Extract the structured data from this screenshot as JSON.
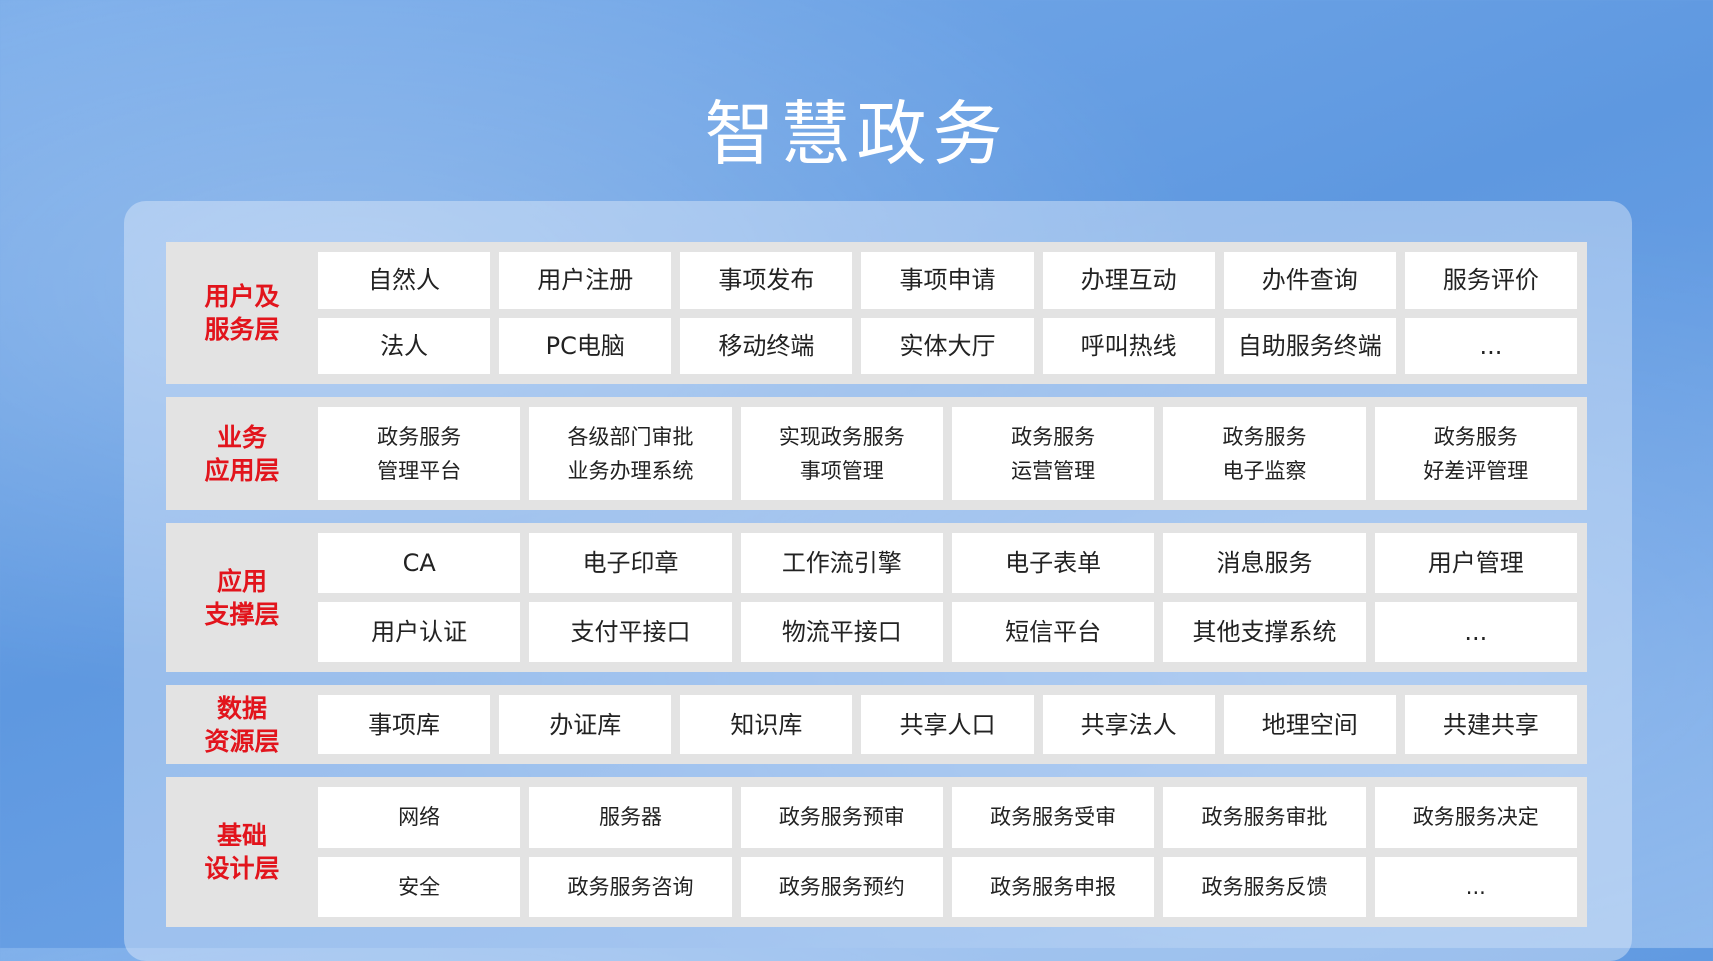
{
  "title": "智慧政务",
  "layers": [
    {
      "label": [
        "用户及",
        "服务层"
      ],
      "cells": [
        [
          "自然人"
        ],
        [
          "用户注册"
        ],
        [
          "事项发布"
        ],
        [
          "事项申请"
        ],
        [
          "办理互动"
        ],
        [
          "办件查询"
        ],
        [
          "服务评价"
        ],
        [
          "法人"
        ],
        [
          "PC电脑"
        ],
        [
          "移动终端"
        ],
        [
          "实体大厅"
        ],
        [
          "呼叫热线"
        ],
        [
          "自助服务终端"
        ],
        [
          "..."
        ]
      ]
    },
    {
      "label": [
        "业务",
        "应用层"
      ],
      "cells": [
        [
          "政务服务",
          "管理平台"
        ],
        [
          "各级部门审批",
          "业务办理系统"
        ],
        [
          "实现政务服务",
          "事项管理"
        ],
        [
          "政务服务",
          "运营管理"
        ],
        [
          "政务服务",
          "电子监察"
        ],
        [
          "政务服务",
          "好差评管理"
        ]
      ]
    },
    {
      "label": [
        "应用",
        "支撑层"
      ],
      "cells": [
        [
          "CA"
        ],
        [
          "电子印章"
        ],
        [
          "工作流引擎"
        ],
        [
          "电子表单"
        ],
        [
          "消息服务"
        ],
        [
          "用户管理"
        ],
        [
          "用户认证"
        ],
        [
          "支付平接口"
        ],
        [
          "物流平接口"
        ],
        [
          "短信平台"
        ],
        [
          "其他支撑系统"
        ],
        [
          "..."
        ]
      ]
    },
    {
      "label": [
        "数据",
        "资源层"
      ],
      "cells": [
        [
          "事项库"
        ],
        [
          "办证库"
        ],
        [
          "知识库"
        ],
        [
          "共享人口"
        ],
        [
          "共享法人"
        ],
        [
          "地理空间"
        ],
        [
          "共建共享"
        ]
      ]
    },
    {
      "label": [
        "基础",
        "设计层"
      ],
      "cells": [
        [
          "网络"
        ],
        [
          "服务器"
        ],
        [
          "政务服务预审"
        ],
        [
          "政务服务受审"
        ],
        [
          "政务服务审批"
        ],
        [
          "政务服务决定"
        ],
        [
          "安全"
        ],
        [
          "政务服务咨询"
        ],
        [
          "政务服务预约"
        ],
        [
          "政务服务申报"
        ],
        [
          "政务服务反馈"
        ],
        [
          "..."
        ]
      ]
    }
  ]
}
